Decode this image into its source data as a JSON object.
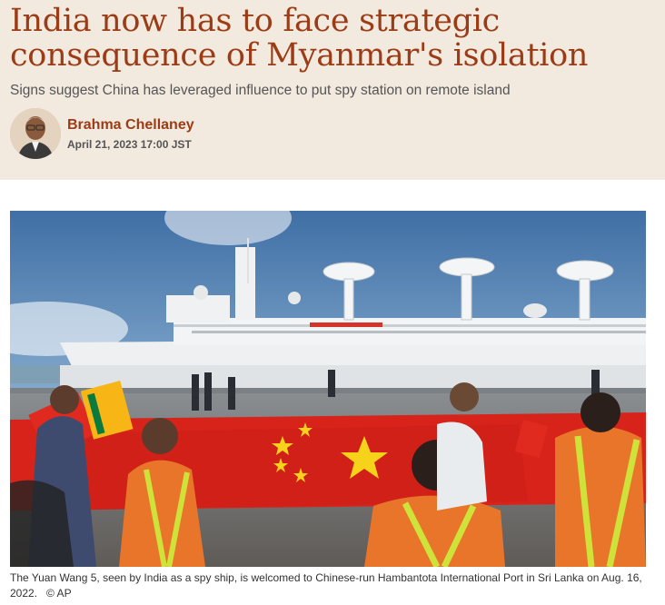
{
  "article": {
    "headline": "India now has to face strategic consequence of Myanmar's isolation",
    "subheadline": "Signs suggest China has leveraged influence to put spy station on remote island",
    "author": "Brahma Chellaney",
    "date": "April 21, 2023 17:00 JST"
  },
  "photo": {
    "caption": "The Yuan Wang 5, seen by India as a spy ship, is welcomed to Chinese-run Hambantota International Port in Sri Lanka on Aug. 16, 2022.",
    "credit": "© AP"
  },
  "colors": {
    "header_bg": "#f2e9df",
    "headline": "#9c3c16",
    "flag_red": "#d8231b",
    "flag_yellow": "#f7d21a"
  }
}
